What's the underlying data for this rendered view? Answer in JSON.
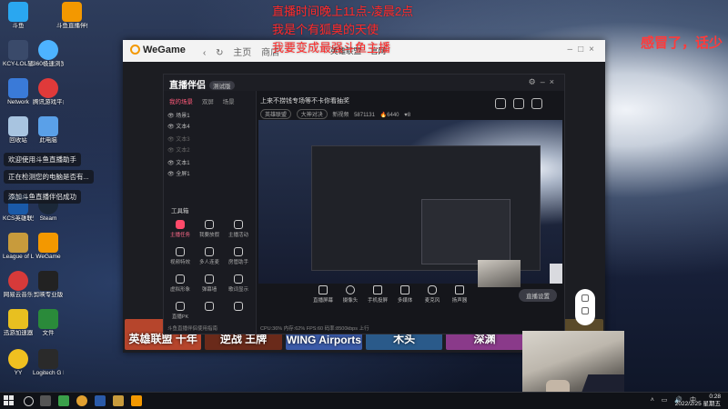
{
  "overlay": {
    "line1": "直播时间晚上11点-凌晨2点",
    "line2": "我是个有狐臭的天使",
    "line3": "我要变成最强斗鱼主播",
    "right_text": "感冒了，话少"
  },
  "desktop": {
    "icons": [
      {
        "label": "斗鱼",
        "color": "#2aa7f0"
      },
      {
        "label": "斗鱼直播伴侣",
        "color": "#f39800"
      },
      {
        "label": "KCY-LOL辅助专用版",
        "color": "#3a4a6a"
      },
      {
        "label": "360极速浏览器",
        "color": "#4db3ff"
      },
      {
        "label": "Network",
        "color": "#3a7ad8"
      },
      {
        "label": "腾讯游戏平台",
        "color": "#e03a3a"
      },
      {
        "label": "回收站",
        "color": "#a8c4e0"
      },
      {
        "label": "此电脑",
        "color": "#5aa0e8"
      },
      {
        "label": "KCS英雄联盟盒子",
        "color": "#1a5aa8"
      },
      {
        "label": "Steam",
        "color": "#1b2838"
      },
      {
        "label": "League of Legends",
        "color": "#c89b3c"
      },
      {
        "label": "WeGame",
        "color": "#f39800"
      },
      {
        "label": "网易云音乐",
        "color": "#d63a3a"
      },
      {
        "label": "剪映专业版",
        "color": "#222222"
      },
      {
        "label": "迅游加速器",
        "color": "#e8c020"
      },
      {
        "label": "文件",
        "color": "#2a8a3a"
      },
      {
        "label": "YY",
        "color": "#f0c020"
      },
      {
        "label": "Logitech G HUB",
        "color": "#2a2a2a"
      }
    ],
    "notifications": [
      "欢迎使用斗鱼直播助手",
      "正在检测您的电脑是否有...",
      "添加斗鱼直播伴侣成功"
    ]
  },
  "wegame": {
    "logo": "WeGame",
    "nav": [
      "主页",
      "商店",
      "社区"
    ],
    "tabs": [
      "英雄联盟",
      "官网",
      "直播"
    ],
    "games": [
      {
        "title": "英雄联盟 十年",
        "color": "#b6452c"
      },
      {
        "title": "逆战 王牌",
        "color": "#6a2a1a"
      },
      {
        "title": "WING Airports",
        "color": "#3a5aa8"
      },
      {
        "title": "木头",
        "color": "#2a5a8a"
      },
      {
        "title": "深渊",
        "color": "#8a3a8a"
      },
      {
        "title": "",
        "color": "#5a4a2a"
      }
    ]
  },
  "zhibo": {
    "logo": "直播伴侣",
    "version": "测试版",
    "side_tabs": [
      "我的场景",
      "双屏",
      "场景"
    ],
    "scenes": [
      "场景1",
      "文本4",
      "文本3",
      "文本2",
      "文本1",
      "全屏1"
    ],
    "tools_title": "工具箱",
    "tools": [
      "主播任务",
      "我要放假",
      "主播活动",
      "视频特效",
      "多人连麦",
      "房管助手",
      "虚拟形象",
      "弹幕墙",
      "歌词显示",
      "直播PK",
      "",
      ""
    ],
    "footer": "斗鱼直播伴侣使用指南",
    "stream_title": "上来不捞钱专场等不卡你看抽奖",
    "meta": {
      "category": "英雄联盟",
      "tag": "大神对决",
      "sub": "新视频",
      "room": "5871131",
      "heat": "6440",
      "fans": "8"
    },
    "controls": [
      "直播屏幕",
      "摄像头",
      "手机投屏",
      "多媒体",
      "麦克风",
      "扬声器"
    ],
    "start_label": "直播设置",
    "status": "CPU:36%  内存:62%  FPS:60  码率:8500kbps  上行"
  },
  "taskbar": {
    "time": "0:28",
    "date": "2022/2/25 星期五"
  }
}
